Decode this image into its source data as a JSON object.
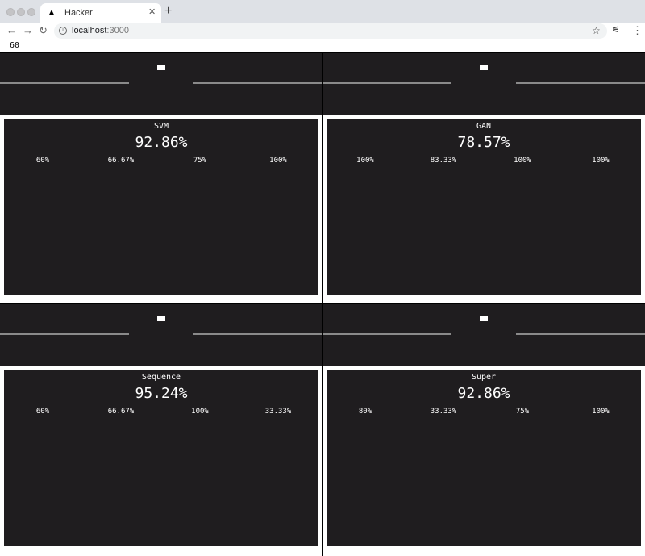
{
  "browser": {
    "tab": {
      "title": "Hacker",
      "icon": "triangle-icon"
    },
    "address": {
      "host": "localhost",
      "port": ":3000"
    }
  },
  "page": {
    "counter": "60",
    "panels": [
      {
        "name": "SVM",
        "score": "92.86%",
        "metrics": [
          "60%",
          "66.67%",
          "75%",
          "100%"
        ]
      },
      {
        "name": "GAN",
        "score": "78.57%",
        "metrics": [
          "100%",
          "83.33%",
          "100%",
          "100%"
        ]
      },
      {
        "name": "Sequence",
        "score": "95.24%",
        "metrics": [
          "60%",
          "66.67%",
          "100%",
          "33.33%"
        ]
      },
      {
        "name": "Super",
        "score": "92.86%",
        "metrics": [
          "80%",
          "33.33%",
          "75%",
          "100%"
        ]
      }
    ]
  }
}
